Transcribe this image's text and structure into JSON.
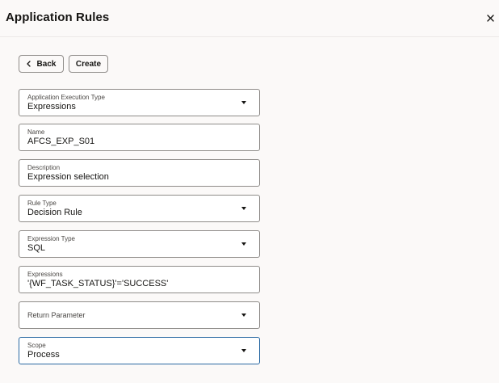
{
  "header": {
    "title": "Application Rules",
    "close_icon": "close-icon"
  },
  "toolbar": {
    "back_label": "Back",
    "back_icon": "chevron-left-icon",
    "create_label": "Create"
  },
  "form": {
    "execution_type": {
      "label": "Application Execution Type",
      "value": "Expressions"
    },
    "name": {
      "label": "Name",
      "value": "AFCS_EXP_S01"
    },
    "description": {
      "label": "Description",
      "value": "Expression selection"
    },
    "rule_type": {
      "label": "Rule Type",
      "value": "Decision Rule"
    },
    "expression_type": {
      "label": "Expression Type",
      "value": "SQL"
    },
    "expressions": {
      "label": "Expressions",
      "value": "'{WF_TASK_STATUS}'='SUCCESS'"
    },
    "return_parameter": {
      "label": "Return Parameter",
      "value": ""
    },
    "scope": {
      "label": "Scope",
      "value": "Process"
    }
  },
  "colors": {
    "background": "#fbf9f8",
    "field_border": "#8f8c89",
    "focus_border": "#2b6aa3",
    "text": "#161513"
  }
}
